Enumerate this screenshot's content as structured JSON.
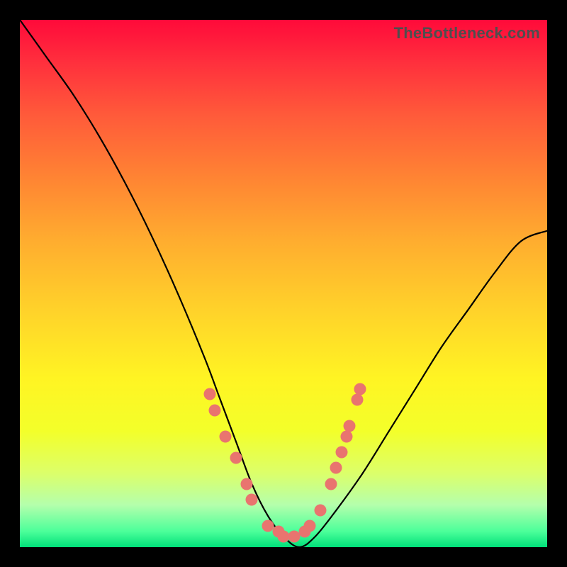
{
  "watermark": "TheBottleneck.com",
  "chart_data": {
    "type": "line",
    "title": "",
    "xlabel": "",
    "ylabel": "",
    "xlim": [
      0,
      100
    ],
    "ylim": [
      0,
      100
    ],
    "grid": false,
    "series": [
      {
        "name": "bottleneck-curve",
        "x": [
          0,
          5,
          10,
          15,
          20,
          25,
          30,
          35,
          38,
          41,
          44,
          47,
          50,
          53,
          56,
          60,
          65,
          70,
          75,
          80,
          85,
          90,
          95,
          100
        ],
        "y": [
          100,
          93,
          86,
          78,
          69,
          59,
          48,
          36,
          28,
          20,
          12,
          6,
          2,
          0,
          2,
          7,
          14,
          22,
          30,
          38,
          45,
          52,
          58,
          60
        ]
      }
    ],
    "markers": [
      {
        "series": "bottleneck-curve",
        "x": 36,
        "y": 29
      },
      {
        "series": "bottleneck-curve",
        "x": 37,
        "y": 26
      },
      {
        "series": "bottleneck-curve",
        "x": 39,
        "y": 21
      },
      {
        "series": "bottleneck-curve",
        "x": 41,
        "y": 17
      },
      {
        "series": "bottleneck-curve",
        "x": 43,
        "y": 12
      },
      {
        "series": "bottleneck-curve",
        "x": 44,
        "y": 9
      },
      {
        "series": "bottleneck-curve",
        "x": 47,
        "y": 4
      },
      {
        "series": "bottleneck-curve",
        "x": 49,
        "y": 3
      },
      {
        "series": "bottleneck-curve",
        "x": 50,
        "y": 2
      },
      {
        "series": "bottleneck-curve",
        "x": 52,
        "y": 2
      },
      {
        "series": "bottleneck-curve",
        "x": 54,
        "y": 3
      },
      {
        "series": "bottleneck-curve",
        "x": 55,
        "y": 4
      },
      {
        "series": "bottleneck-curve",
        "x": 57,
        "y": 7
      },
      {
        "series": "bottleneck-curve",
        "x": 59,
        "y": 12
      },
      {
        "series": "bottleneck-curve",
        "x": 60,
        "y": 15
      },
      {
        "series": "bottleneck-curve",
        "x": 61,
        "y": 18
      },
      {
        "series": "bottleneck-curve",
        "x": 62,
        "y": 21
      },
      {
        "series": "bottleneck-curve",
        "x": 62.5,
        "y": 23
      },
      {
        "series": "bottleneck-curve",
        "x": 64,
        "y": 28
      },
      {
        "series": "bottleneck-curve",
        "x": 64.5,
        "y": 30
      }
    ],
    "background_gradient": {
      "orientation": "vertical",
      "stops": [
        {
          "pos": 0,
          "color": "#ff0a3a"
        },
        {
          "pos": 0.5,
          "color": "#ffd22a"
        },
        {
          "pos": 1,
          "color": "#00e07a"
        }
      ]
    }
  }
}
